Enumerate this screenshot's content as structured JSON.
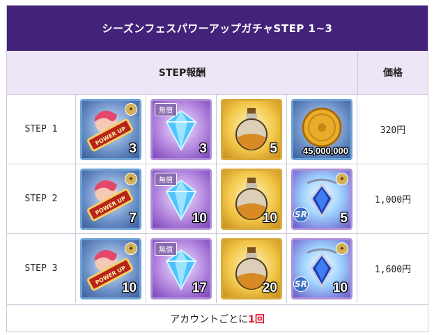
{
  "title": "シーズンフェスパワーアップガチャSTEP 1~3",
  "headers": {
    "reward": "STEP報酬",
    "price": "価格"
  },
  "rows": [
    {
      "step": "STEP 1",
      "price": "320円",
      "items": [
        {
          "icon": "power-up-ticket-icon",
          "count": "3"
        },
        {
          "icon": "diamond-icon",
          "count": "3",
          "tag": "無償"
        },
        {
          "icon": "potion-icon",
          "count": "5"
        },
        {
          "icon": "gold-coin-icon",
          "count": "45,000,000"
        }
      ]
    },
    {
      "step": "STEP 2",
      "price": "1,000円",
      "items": [
        {
          "icon": "power-up-ticket-icon",
          "count": "7"
        },
        {
          "icon": "diamond-icon",
          "count": "10",
          "tag": "無償"
        },
        {
          "icon": "potion-icon",
          "count": "10"
        },
        {
          "icon": "sr-pendant-icon",
          "count": "5",
          "badge": "SR"
        }
      ]
    },
    {
      "step": "STEP 3",
      "price": "1,600円",
      "items": [
        {
          "icon": "power-up-ticket-icon",
          "count": "10"
        },
        {
          "icon": "diamond-icon",
          "count": "17",
          "tag": "無償"
        },
        {
          "icon": "potion-icon",
          "count": "20"
        },
        {
          "icon": "sr-pendant-icon",
          "count": "10",
          "badge": "SR"
        }
      ]
    }
  ],
  "footer": {
    "prefix": "アカウントごとに",
    "limit": "1回"
  },
  "colors": {
    "title_bg": "#43237a",
    "header_bg": "#ece6f7",
    "limit_red": "#e0102a"
  }
}
